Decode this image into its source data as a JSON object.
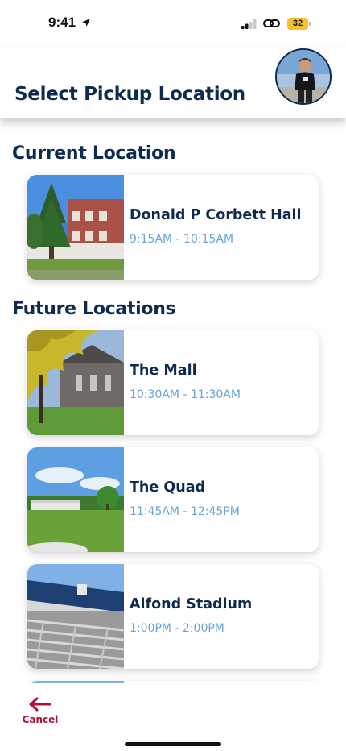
{
  "status_bar": {
    "time": "9:41",
    "battery": "32"
  },
  "header": {
    "title": "Select Pickup Location"
  },
  "current": {
    "section_title": "Current Location",
    "locations": [
      {
        "name": "Donald P Corbett Hall",
        "hours": "9:15AM - 10:15AM"
      }
    ]
  },
  "future": {
    "section_title": "Future Locations",
    "locations": [
      {
        "name": "The Mall",
        "hours": "10:30AM - 11:30AM"
      },
      {
        "name": "The Quad",
        "hours": "11:45AM - 12:45PM"
      },
      {
        "name": "Alfond Stadium",
        "hours": "1:00PM - 2:00PM"
      }
    ]
  },
  "footer": {
    "cancel_label": "Cancel"
  },
  "colors": {
    "navy": "#0f2a4f",
    "time_blue": "#6aa2d6",
    "cancel_red": "#b0123b",
    "battery_yellow": "#f2c230"
  }
}
